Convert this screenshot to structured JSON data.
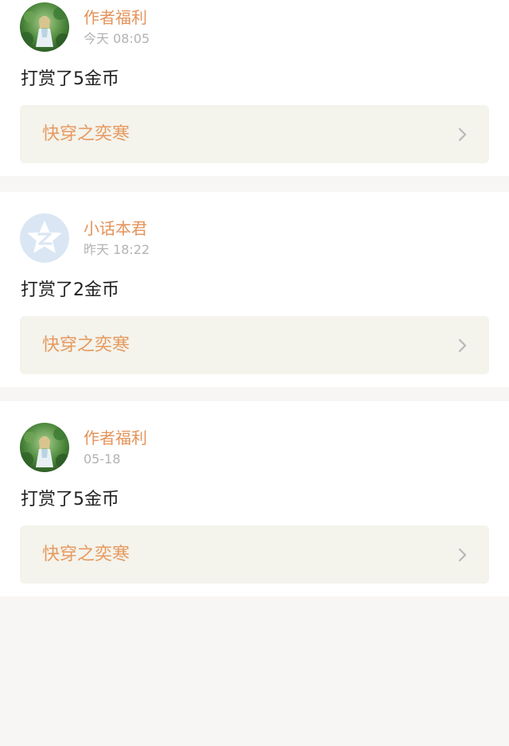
{
  "feed": {
    "items": [
      {
        "avatar": "anime-girl-forest-avatar",
        "name": "作者福利",
        "time": "今天 08:05",
        "action": "打赏了5金币",
        "book_title": "快穿之奕寒",
        "chevron": "chevron-right-icon"
      },
      {
        "avatar": "z-star-logo-avatar",
        "name": "小话本君",
        "time": "昨天 18:22",
        "action": "打赏了2金币",
        "book_title": "快穿之奕寒",
        "chevron": "chevron-right-icon"
      },
      {
        "avatar": "anime-girl-forest-avatar",
        "name": "作者福利",
        "time": "05-18",
        "action": "打赏了5金币",
        "book_title": "快穿之奕寒",
        "chevron": "chevron-right-icon"
      }
    ]
  },
  "colors": {
    "page_background": "#f8f6f5",
    "card_background": "#ffffff",
    "username": "#e3935a",
    "timestamp": "#b3b3b3",
    "action_text": "#222222",
    "book_link_background": "#f4f3ec",
    "book_title": "#e69a5f",
    "chevron": "#b8b8b8"
  }
}
